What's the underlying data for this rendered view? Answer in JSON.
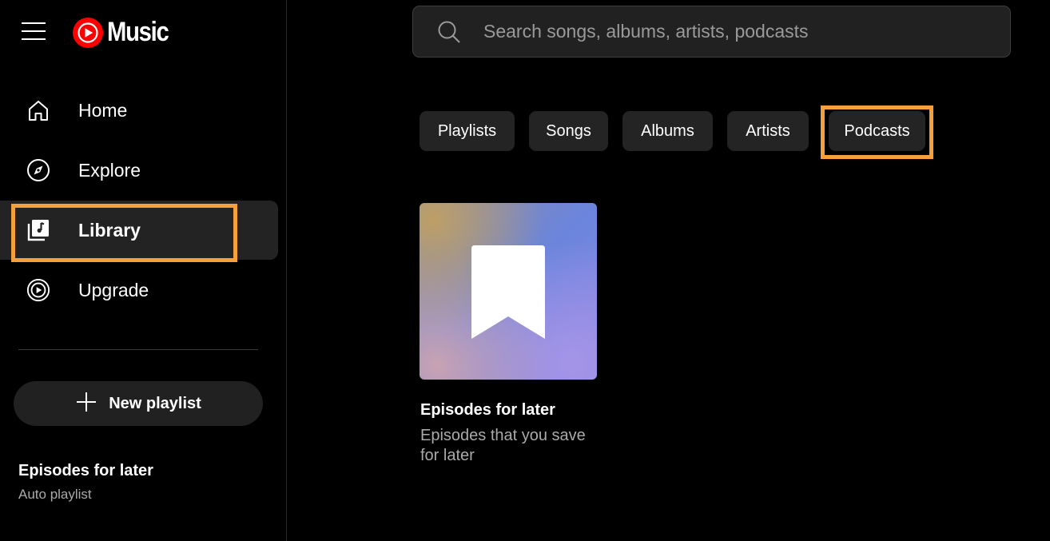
{
  "app": {
    "logo_text": "Music",
    "brand_color": "#ff0000",
    "highlight_color": "#f5a03a"
  },
  "sidebar": {
    "items": [
      {
        "label": "Home",
        "icon": "home-icon"
      },
      {
        "label": "Explore",
        "icon": "compass-icon"
      },
      {
        "label": "Library",
        "icon": "library-icon",
        "active": true
      },
      {
        "label": "Upgrade",
        "icon": "upgrade-icon"
      }
    ],
    "new_playlist_label": "New playlist",
    "playlists": [
      {
        "title": "Episodes for later",
        "subtitle": "Auto playlist"
      }
    ]
  },
  "search": {
    "placeholder": "Search songs, albums, artists, podcasts",
    "value": ""
  },
  "chips": [
    {
      "label": "Playlists"
    },
    {
      "label": "Songs"
    },
    {
      "label": "Albums"
    },
    {
      "label": "Artists"
    },
    {
      "label": "Podcasts",
      "selected": true
    }
  ],
  "cards": [
    {
      "title": "Episodes for later",
      "subtitle": "Episodes that you save for later",
      "icon": "bookmark-icon"
    }
  ]
}
